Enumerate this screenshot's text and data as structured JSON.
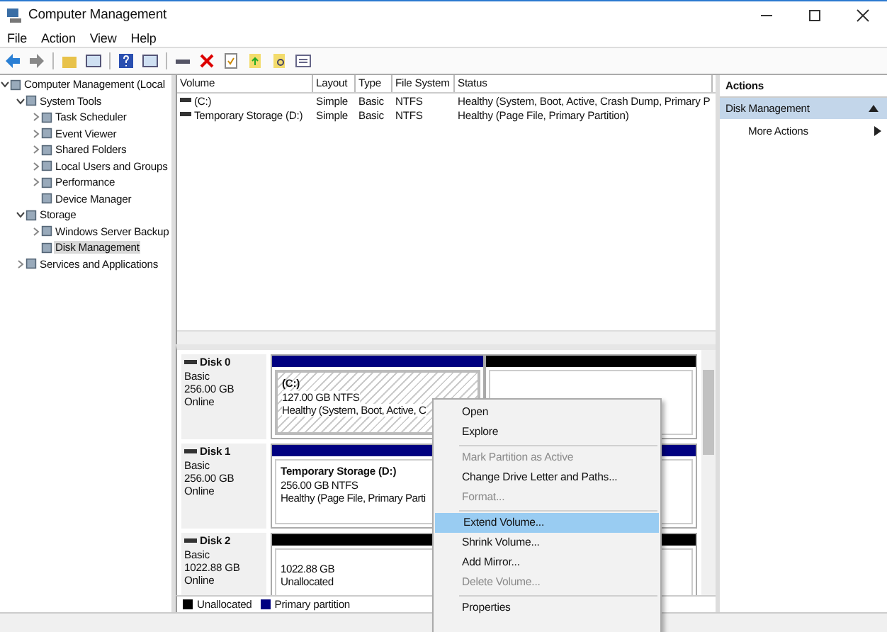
{
  "window": {
    "title": "Computer Management"
  },
  "menu": [
    "File",
    "Action",
    "View",
    "Help"
  ],
  "tree": [
    {
      "label": "Computer Management (Local",
      "expanded": true,
      "selected": false,
      "children": [
        {
          "label": "System Tools",
          "expanded": true,
          "selected": false,
          "children": [
            {
              "label": "Task Scheduler",
              "expanded": false,
              "selected": false
            },
            {
              "label": "Event Viewer",
              "expanded": false,
              "selected": false
            },
            {
              "label": "Shared Folders",
              "expanded": false,
              "selected": false
            },
            {
              "label": "Local Users and Groups",
              "expanded": false,
              "selected": false
            },
            {
              "label": "Performance",
              "expanded": false,
              "selected": false
            },
            {
              "label": "Device Manager",
              "selected": false
            }
          ]
        },
        {
          "label": "Storage",
          "expanded": true,
          "selected": false,
          "children": [
            {
              "label": "Windows Server Backup",
              "expanded": false,
              "selected": false
            },
            {
              "label": "Disk Management",
              "selected": true
            }
          ]
        },
        {
          "label": "Services and Applications",
          "expanded": false,
          "selected": false
        }
      ]
    }
  ],
  "volumes": {
    "columns": [
      "Volume",
      "Layout",
      "Type",
      "File System",
      "Status"
    ],
    "rows": [
      [
        "(C:)",
        "Simple",
        "Basic",
        "NTFS",
        "Healthy (System, Boot, Active, Crash Dump, Primary P"
      ],
      [
        "Temporary Storage (D:)",
        "Simple",
        "Basic",
        "NTFS",
        "Healthy (Page File, Primary Partition)"
      ]
    ]
  },
  "actions": {
    "title": "Actions",
    "section": "Disk Management",
    "items": [
      "More Actions"
    ]
  },
  "disks": [
    {
      "name": "Disk 0",
      "lines": [
        "Basic",
        "256.00 GB",
        "Online"
      ],
      "partitions": [
        {
          "kind": "primary",
          "selected": true,
          "title": "(C:)",
          "lines": [
            "127.00 GB NTFS",
            "Healthy (System, Boot, Active, C"
          ]
        },
        {
          "kind": "unallocated",
          "selected": false
        }
      ]
    },
    {
      "name": "Disk 1",
      "lines": [
        "Basic",
        "256.00 GB",
        "Online"
      ],
      "partitions": [
        {
          "kind": "primary",
          "selected": false,
          "title": "Temporary Storage  (D:)",
          "lines": [
            "256.00 GB NTFS",
            "Healthy (Page File, Primary Parti"
          ]
        }
      ]
    },
    {
      "name": "Disk 2",
      "lines": [
        "Basic",
        "1022.88 GB",
        "Online"
      ],
      "partitions": [
        {
          "kind": "unallocated",
          "selected": false,
          "lines": [
            "1022.88 GB",
            "Unallocated"
          ]
        }
      ]
    }
  ],
  "legend": [
    {
      "label": "Unallocated",
      "color": "#000000"
    },
    {
      "label": "Primary partition",
      "color": "#000080"
    }
  ],
  "context_menu": [
    {
      "kind": "item",
      "label": "Open",
      "disabled": false,
      "selected": false
    },
    {
      "kind": "item",
      "label": "Explore",
      "disabled": false,
      "selected": false
    },
    {
      "kind": "separator"
    },
    {
      "kind": "item",
      "label": "Mark Partition as Active",
      "disabled": true,
      "selected": false
    },
    {
      "kind": "item",
      "label": "Change Drive Letter and Paths...",
      "disabled": false,
      "selected": false
    },
    {
      "kind": "item",
      "label": "Format...",
      "disabled": true,
      "selected": false
    },
    {
      "kind": "separator"
    },
    {
      "kind": "item",
      "label": "Extend Volume...",
      "disabled": false,
      "selected": true
    },
    {
      "kind": "item",
      "label": "Shrink Volume...",
      "disabled": false,
      "selected": false
    },
    {
      "kind": "item",
      "label": "Add Mirror...",
      "disabled": false,
      "selected": false
    },
    {
      "kind": "item",
      "label": "Delete Volume...",
      "disabled": true,
      "selected": false
    },
    {
      "kind": "separator"
    },
    {
      "kind": "item",
      "label": "Properties",
      "disabled": false,
      "selected": false
    }
  ]
}
